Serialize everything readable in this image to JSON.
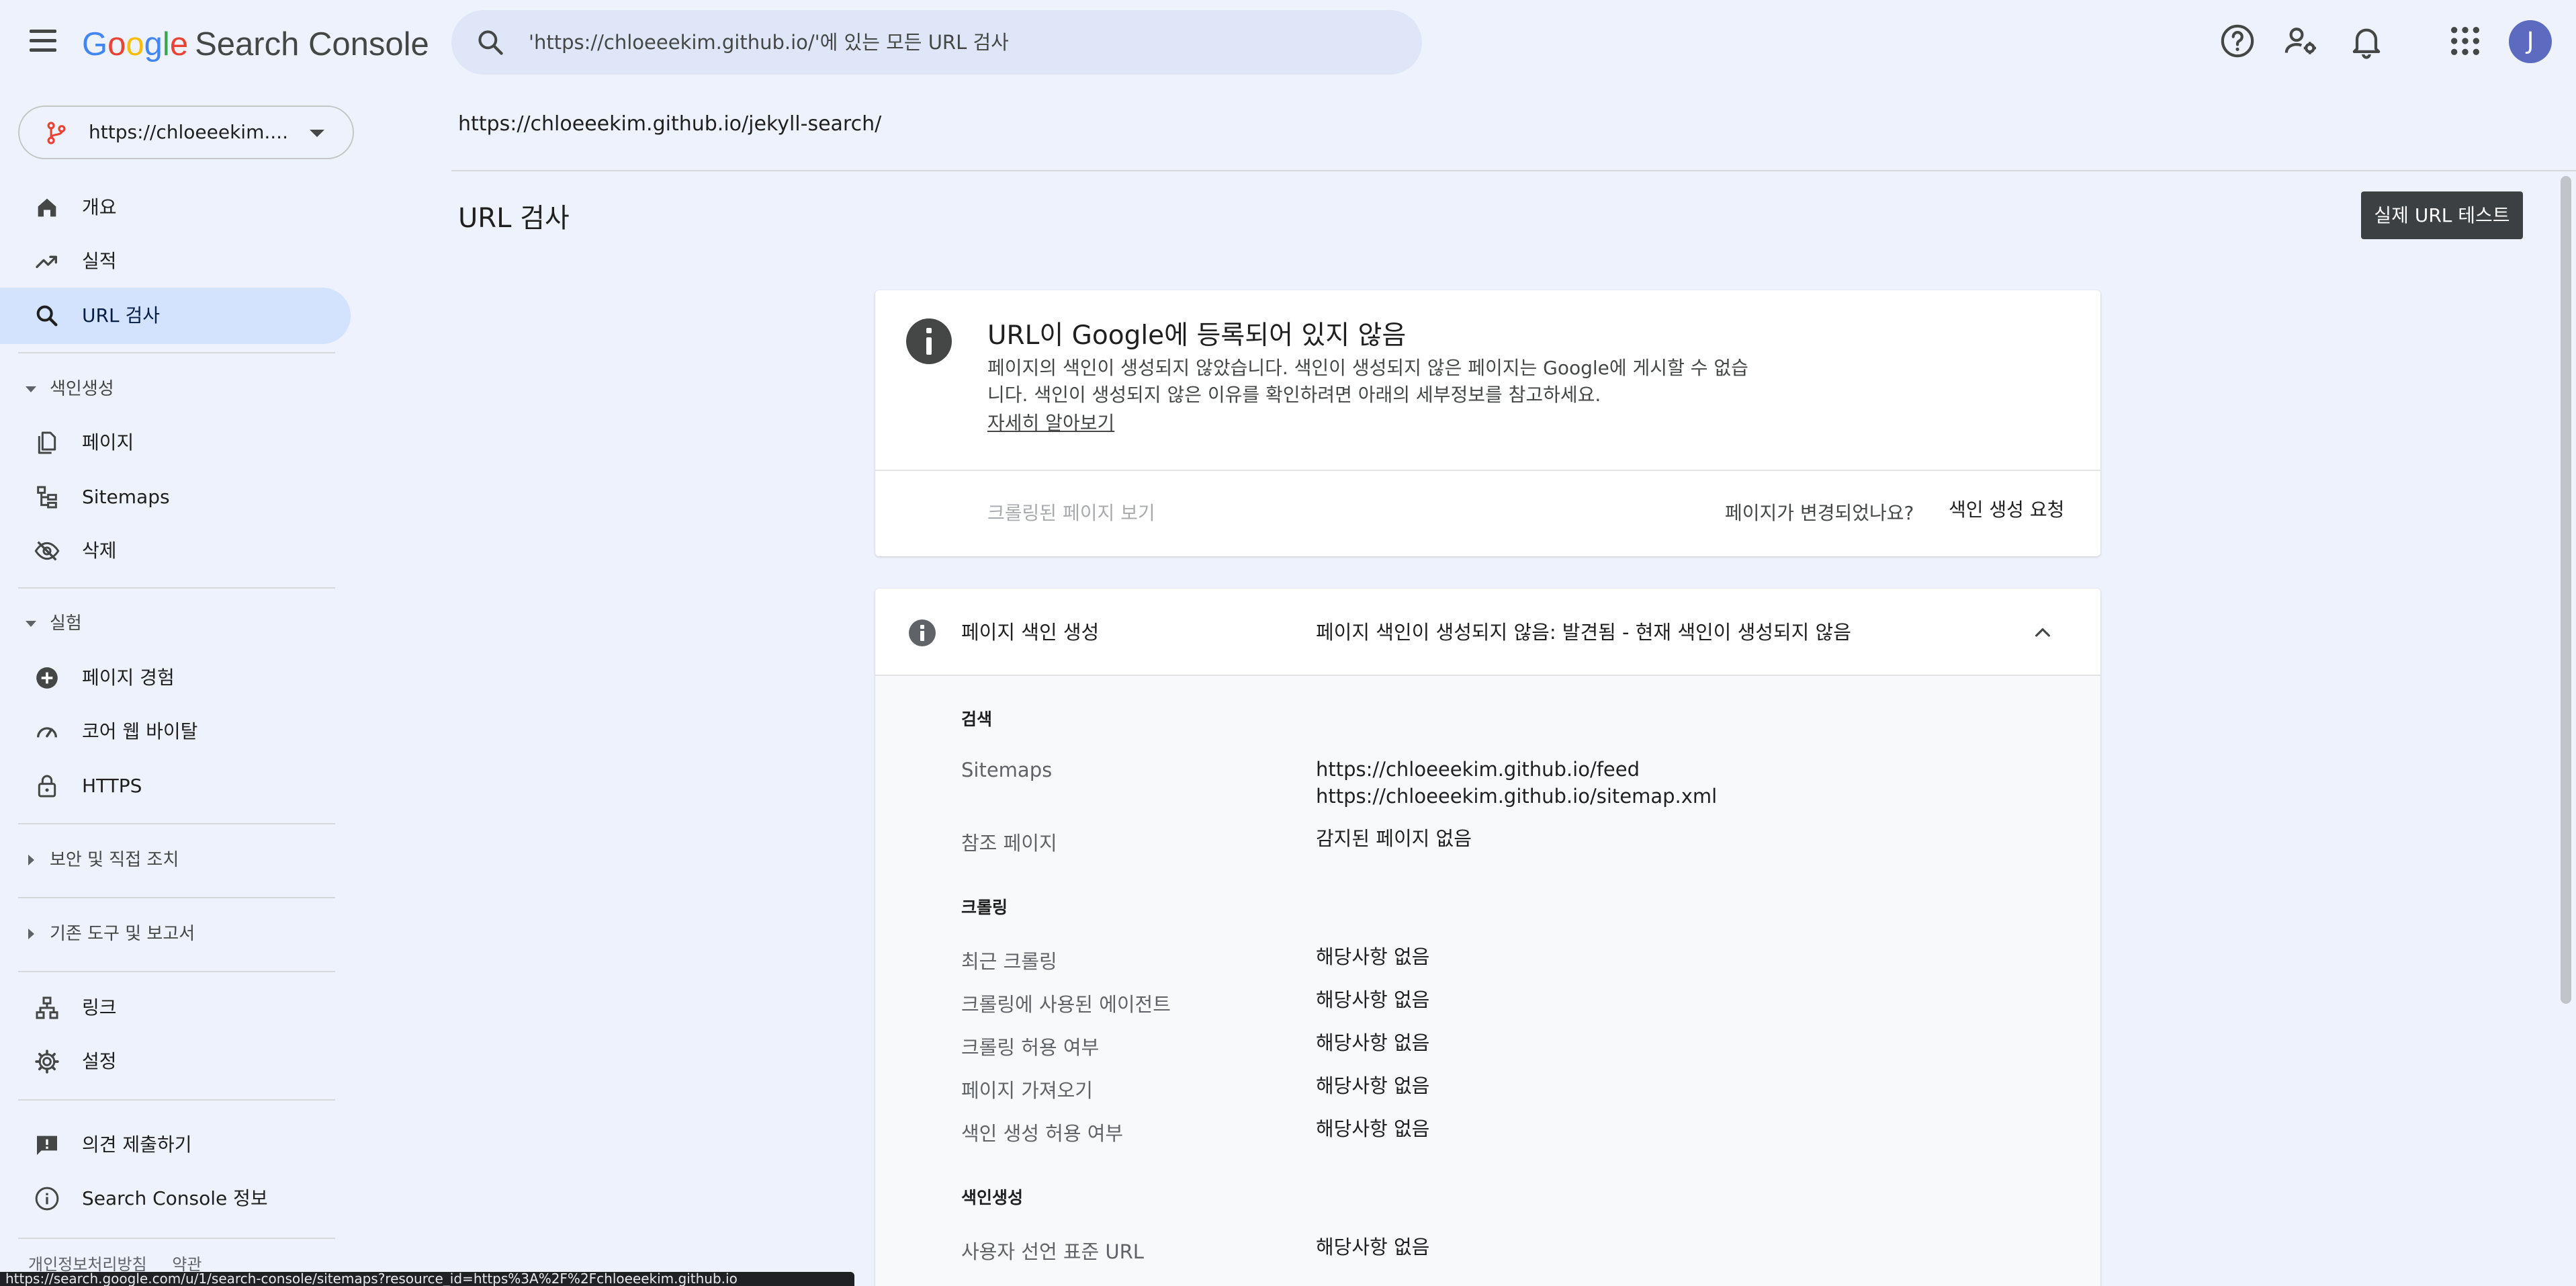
{
  "app": {
    "logo_letters": [
      "G",
      "o",
      "o",
      "g",
      "l",
      "e"
    ],
    "product_name": "Search Console"
  },
  "colors": {
    "google_blue": "#4285f4",
    "google_red": "#ea4335",
    "google_yellow": "#fbbc04",
    "google_green": "#34a853",
    "background": "#eef2fc",
    "active_nav": "#d3e3fd",
    "primary_button": "#3c4043",
    "avatar": "#5c6bc0"
  },
  "search": {
    "placeholder": "'https://chloeeekim.github.io/'에 있는 모든 URL 검사"
  },
  "topbar": {
    "icons": [
      "help-icon",
      "manage-users-icon",
      "notifications-icon",
      "apps-grid-icon"
    ],
    "avatar_initial": "J"
  },
  "property": {
    "label": "https://chloeeekim...."
  },
  "sidebar": {
    "top_items": [
      {
        "label": "개요",
        "icon": "home-icon"
      },
      {
        "label": "실적",
        "icon": "trending-up-icon"
      },
      {
        "label": "URL 검사",
        "icon": "search-icon",
        "active": true
      }
    ],
    "indexing": {
      "title": "색인생성",
      "items": [
        {
          "label": "페이지",
          "icon": "pages-icon"
        },
        {
          "label": "Sitemaps",
          "icon": "sitemap-icon"
        },
        {
          "label": "삭제",
          "icon": "visibility-off-icon"
        }
      ]
    },
    "experience": {
      "title": "실험",
      "items": [
        {
          "label": "페이지 경험",
          "icon": "add-circle-icon"
        },
        {
          "label": "코어 웹 바이탈",
          "icon": "speed-gauge-icon"
        },
        {
          "label": "HTTPS",
          "icon": "lock-icon"
        }
      ]
    },
    "security_title": "보안 및 직접 조치",
    "legacy_title": "기존 도구 및 보고서",
    "bottom_items": [
      {
        "label": "링크",
        "icon": "links-icon"
      },
      {
        "label": "설정",
        "icon": "settings-icon"
      }
    ],
    "extra_items": [
      {
        "label": "의견 제출하기",
        "icon": "feedback-icon"
      },
      {
        "label": "Search Console 정보",
        "icon": "info-icon"
      }
    ],
    "footer": {
      "privacy": "개인정보처리방침",
      "terms": "약관"
    }
  },
  "status_bar": {
    "url": "https://search.google.com/u/1/search-console/sitemaps?resource_id=https%3A%2F%2Fchloeeekim.github.io"
  },
  "main": {
    "inspected_url": "https://chloeeekim.github.io/jekyll-search/",
    "page_title": "URL 검사",
    "live_test_button": "실제 URL 테스트",
    "status_card": {
      "title": "URL이 Google에 등록되어 있지 않음",
      "description": "페이지의 색인이 생성되지 않았습니다. 색인이 생성되지 않은 페이지는 Google에 게시할 수 없습니다. 색인이 생성되지 않은 이유를 확인하려면 아래의 세부정보를 참고하세요.",
      "learn_more": "자세히 알아보기",
      "view_crawled": "크롤링된 페이지 보기",
      "page_changed": "페이지가 변경되었나요?",
      "request_indexing": "색인 생성 요청"
    },
    "indexing_card": {
      "label": "페이지 색인 생성",
      "status": "페이지 색인이 생성되지 않음: 발견됨 - 현재 색인이 생성되지 않음",
      "discovery": {
        "title": "검색",
        "sitemaps_label": "Sitemaps",
        "sitemaps": [
          "https://chloeeekim.github.io/feed",
          "https://chloeeekim.github.io/sitemap.xml"
        ],
        "referring_label": "참조 페이지",
        "referring_value": "감지된 페이지 없음"
      },
      "crawl": {
        "title": "크롤링",
        "rows": [
          {
            "label": "최근 크롤링",
            "value": "해당사항 없음"
          },
          {
            "label": "크롤링에 사용된 에이전트",
            "value": "해당사항 없음"
          },
          {
            "label": "크롤링 허용 여부",
            "value": "해당사항 없음"
          },
          {
            "label": "페이지 가져오기",
            "value": "해당사항 없음"
          },
          {
            "label": "색인 생성 허용 여부",
            "value": "해당사항 없음"
          }
        ]
      },
      "indexing": {
        "title": "색인생성",
        "rows": [
          {
            "label": "사용자 선언 표준 URL",
            "value": "해당사항 없음"
          }
        ]
      }
    }
  }
}
